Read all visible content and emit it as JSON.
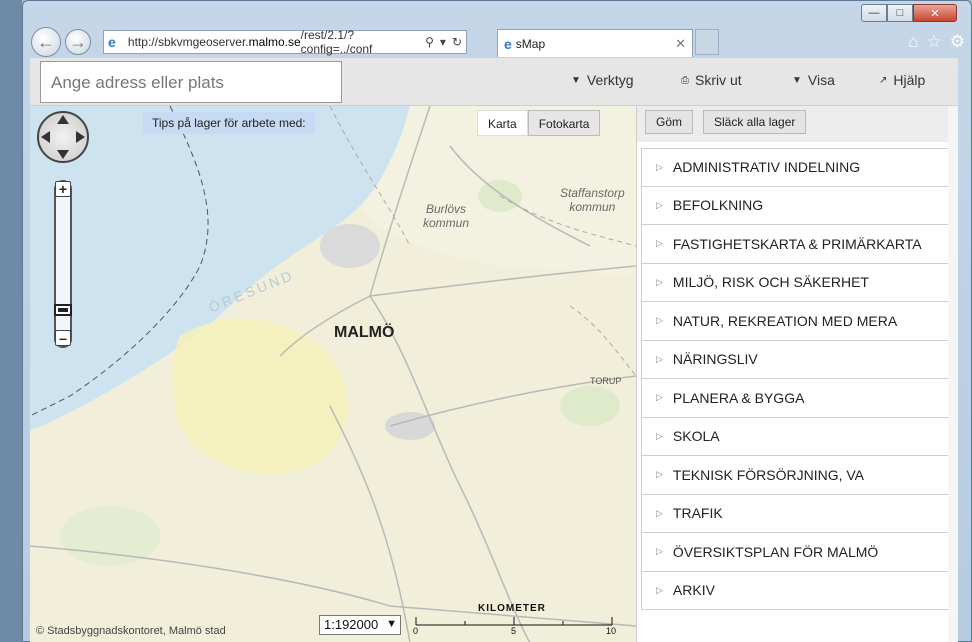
{
  "browser": {
    "url_prefix": "http://sbkvmgeoserver.",
    "url_host": "malmo.se",
    "url_suffix": "/rest/2.1/?config=../conf",
    "tab_title": "sMap"
  },
  "search": {
    "placeholder": "Ange adress eller plats"
  },
  "menu": {
    "tools": "Verktyg",
    "print": "Skriv ut",
    "view": "Visa",
    "help": "Hjälp"
  },
  "map": {
    "tip": "Tips på lager för arbete med:",
    "basemap_map": "Karta",
    "basemap_photo": "Fotokarta",
    "copyright": "© Stadsbyggnadskontoret, Malmö stad",
    "scale": "1:192000",
    "scalebar_title": "KILOMETER",
    "scalebar_ticks": [
      "0",
      "5",
      "10"
    ],
    "labels": {
      "city": "MALMÖ",
      "burlov": "Burlövs\nkommun",
      "staffanstorp": "Staffanstorp\nkommun",
      "oresund": "ÖRESUND",
      "torup": "TORUP"
    }
  },
  "sidebar": {
    "hide": "Göm",
    "clear_layers": "Släck alla lager",
    "categories": [
      "ADMINISTRATIV INDELNING",
      "BEFOLKNING",
      "FASTIGHETSKARTA & PRIMÄRKARTA",
      "MILJÖ, RISK OCH SÄKERHET",
      "NATUR, REKREATION MED MERA",
      "NÄRINGSLIV",
      "PLANERA & BYGGA",
      "SKOLA",
      "TEKNISK FÖRSÖRJNING, VA",
      "TRAFIK",
      "ÖVERSIKTSPLAN FÖR MALMÖ",
      "ARKIV"
    ]
  }
}
